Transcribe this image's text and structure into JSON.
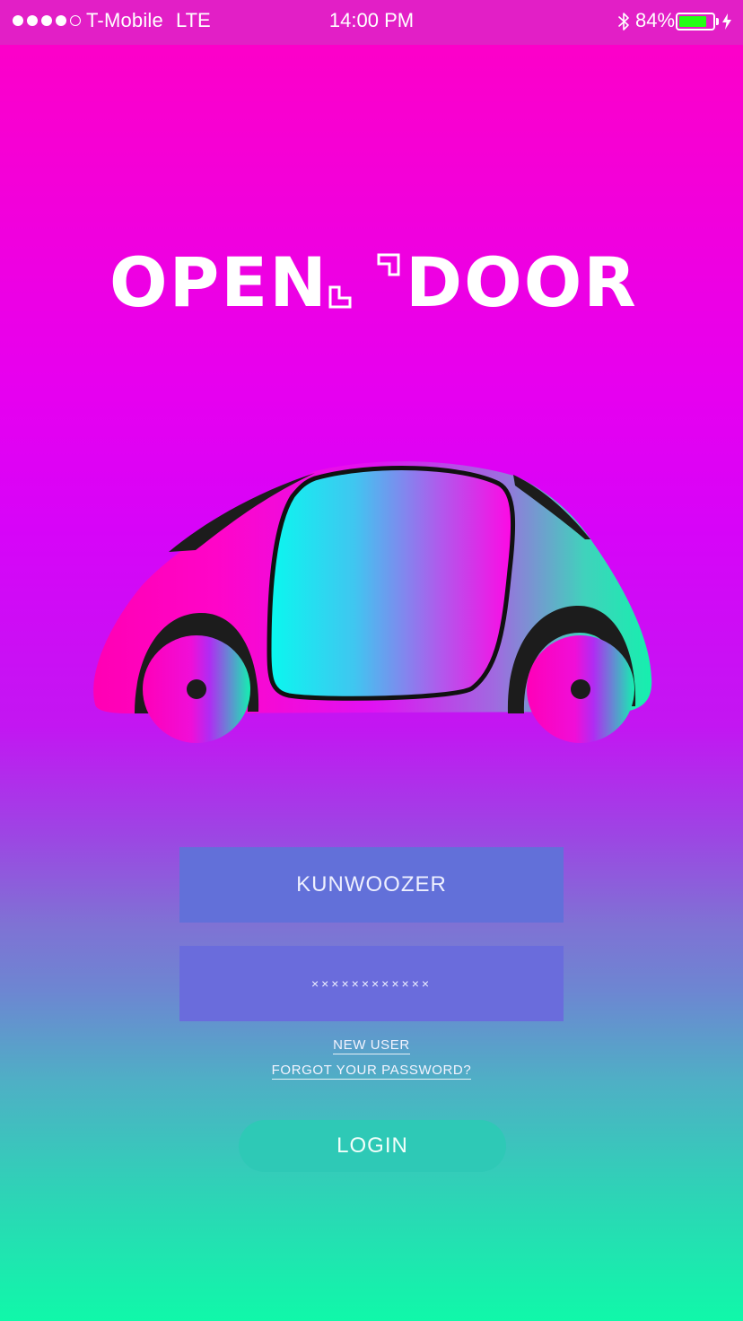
{
  "status_bar": {
    "carrier": "T-Mobile",
    "network": "LTE",
    "time": "14:00 PM",
    "battery_percent": "84%",
    "signal_bars_filled": 4,
    "signal_bars_total": 5,
    "battery_level": 0.84,
    "battery_color": "#23ff14",
    "icons": [
      "bluetooth-icon",
      "battery-icon",
      "charging-icon"
    ]
  },
  "logo": {
    "word_left": "OPEN",
    "word_right": "DOOR"
  },
  "illustration": {
    "name": "car-illustration"
  },
  "form": {
    "username_value": "KUNWOOZER",
    "password_value": "××××××××××××",
    "new_user_link": "NEW USER",
    "forgot_password_link": "FORGOT YOUR PASSWORD?",
    "login_button": "LOGIN"
  },
  "colors": {
    "background_top": "#ff00c4",
    "background_bottom": "#10f8a9",
    "status_bar": "#e21fc6",
    "field_background": "#6270d9",
    "login_button": "#2ec9b6"
  }
}
